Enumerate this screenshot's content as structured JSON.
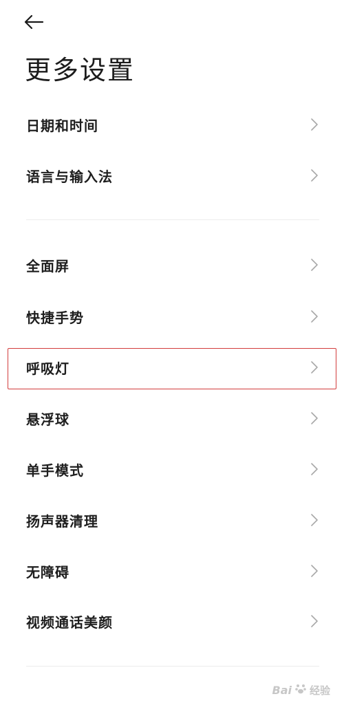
{
  "header": {
    "back_icon": "arrow-left-icon",
    "title": "更多设置"
  },
  "group1": [
    {
      "label": "日期和时间",
      "icon": "chevron-right-icon"
    },
    {
      "label": "语言与输入法",
      "icon": "chevron-right-icon"
    }
  ],
  "group2": [
    {
      "label": "全面屏",
      "icon": "chevron-right-icon"
    },
    {
      "label": "快捷手势",
      "icon": "chevron-right-icon"
    },
    {
      "label": "呼吸灯",
      "icon": "chevron-right-icon",
      "highlighted": true
    },
    {
      "label": "悬浮球",
      "icon": "chevron-right-icon"
    },
    {
      "label": "单手模式",
      "icon": "chevron-right-icon"
    },
    {
      "label": "扬声器清理",
      "icon": "chevron-right-icon"
    },
    {
      "label": "无障碍",
      "icon": "chevron-right-icon"
    },
    {
      "label": "视频通话美颜",
      "icon": "chevron-right-icon"
    }
  ],
  "watermark": {
    "brand": "Bai",
    "suffix": "经验"
  },
  "colors": {
    "highlight": "#d23b3b",
    "chevron": "#a8a8a8",
    "divider": "#ececec"
  }
}
